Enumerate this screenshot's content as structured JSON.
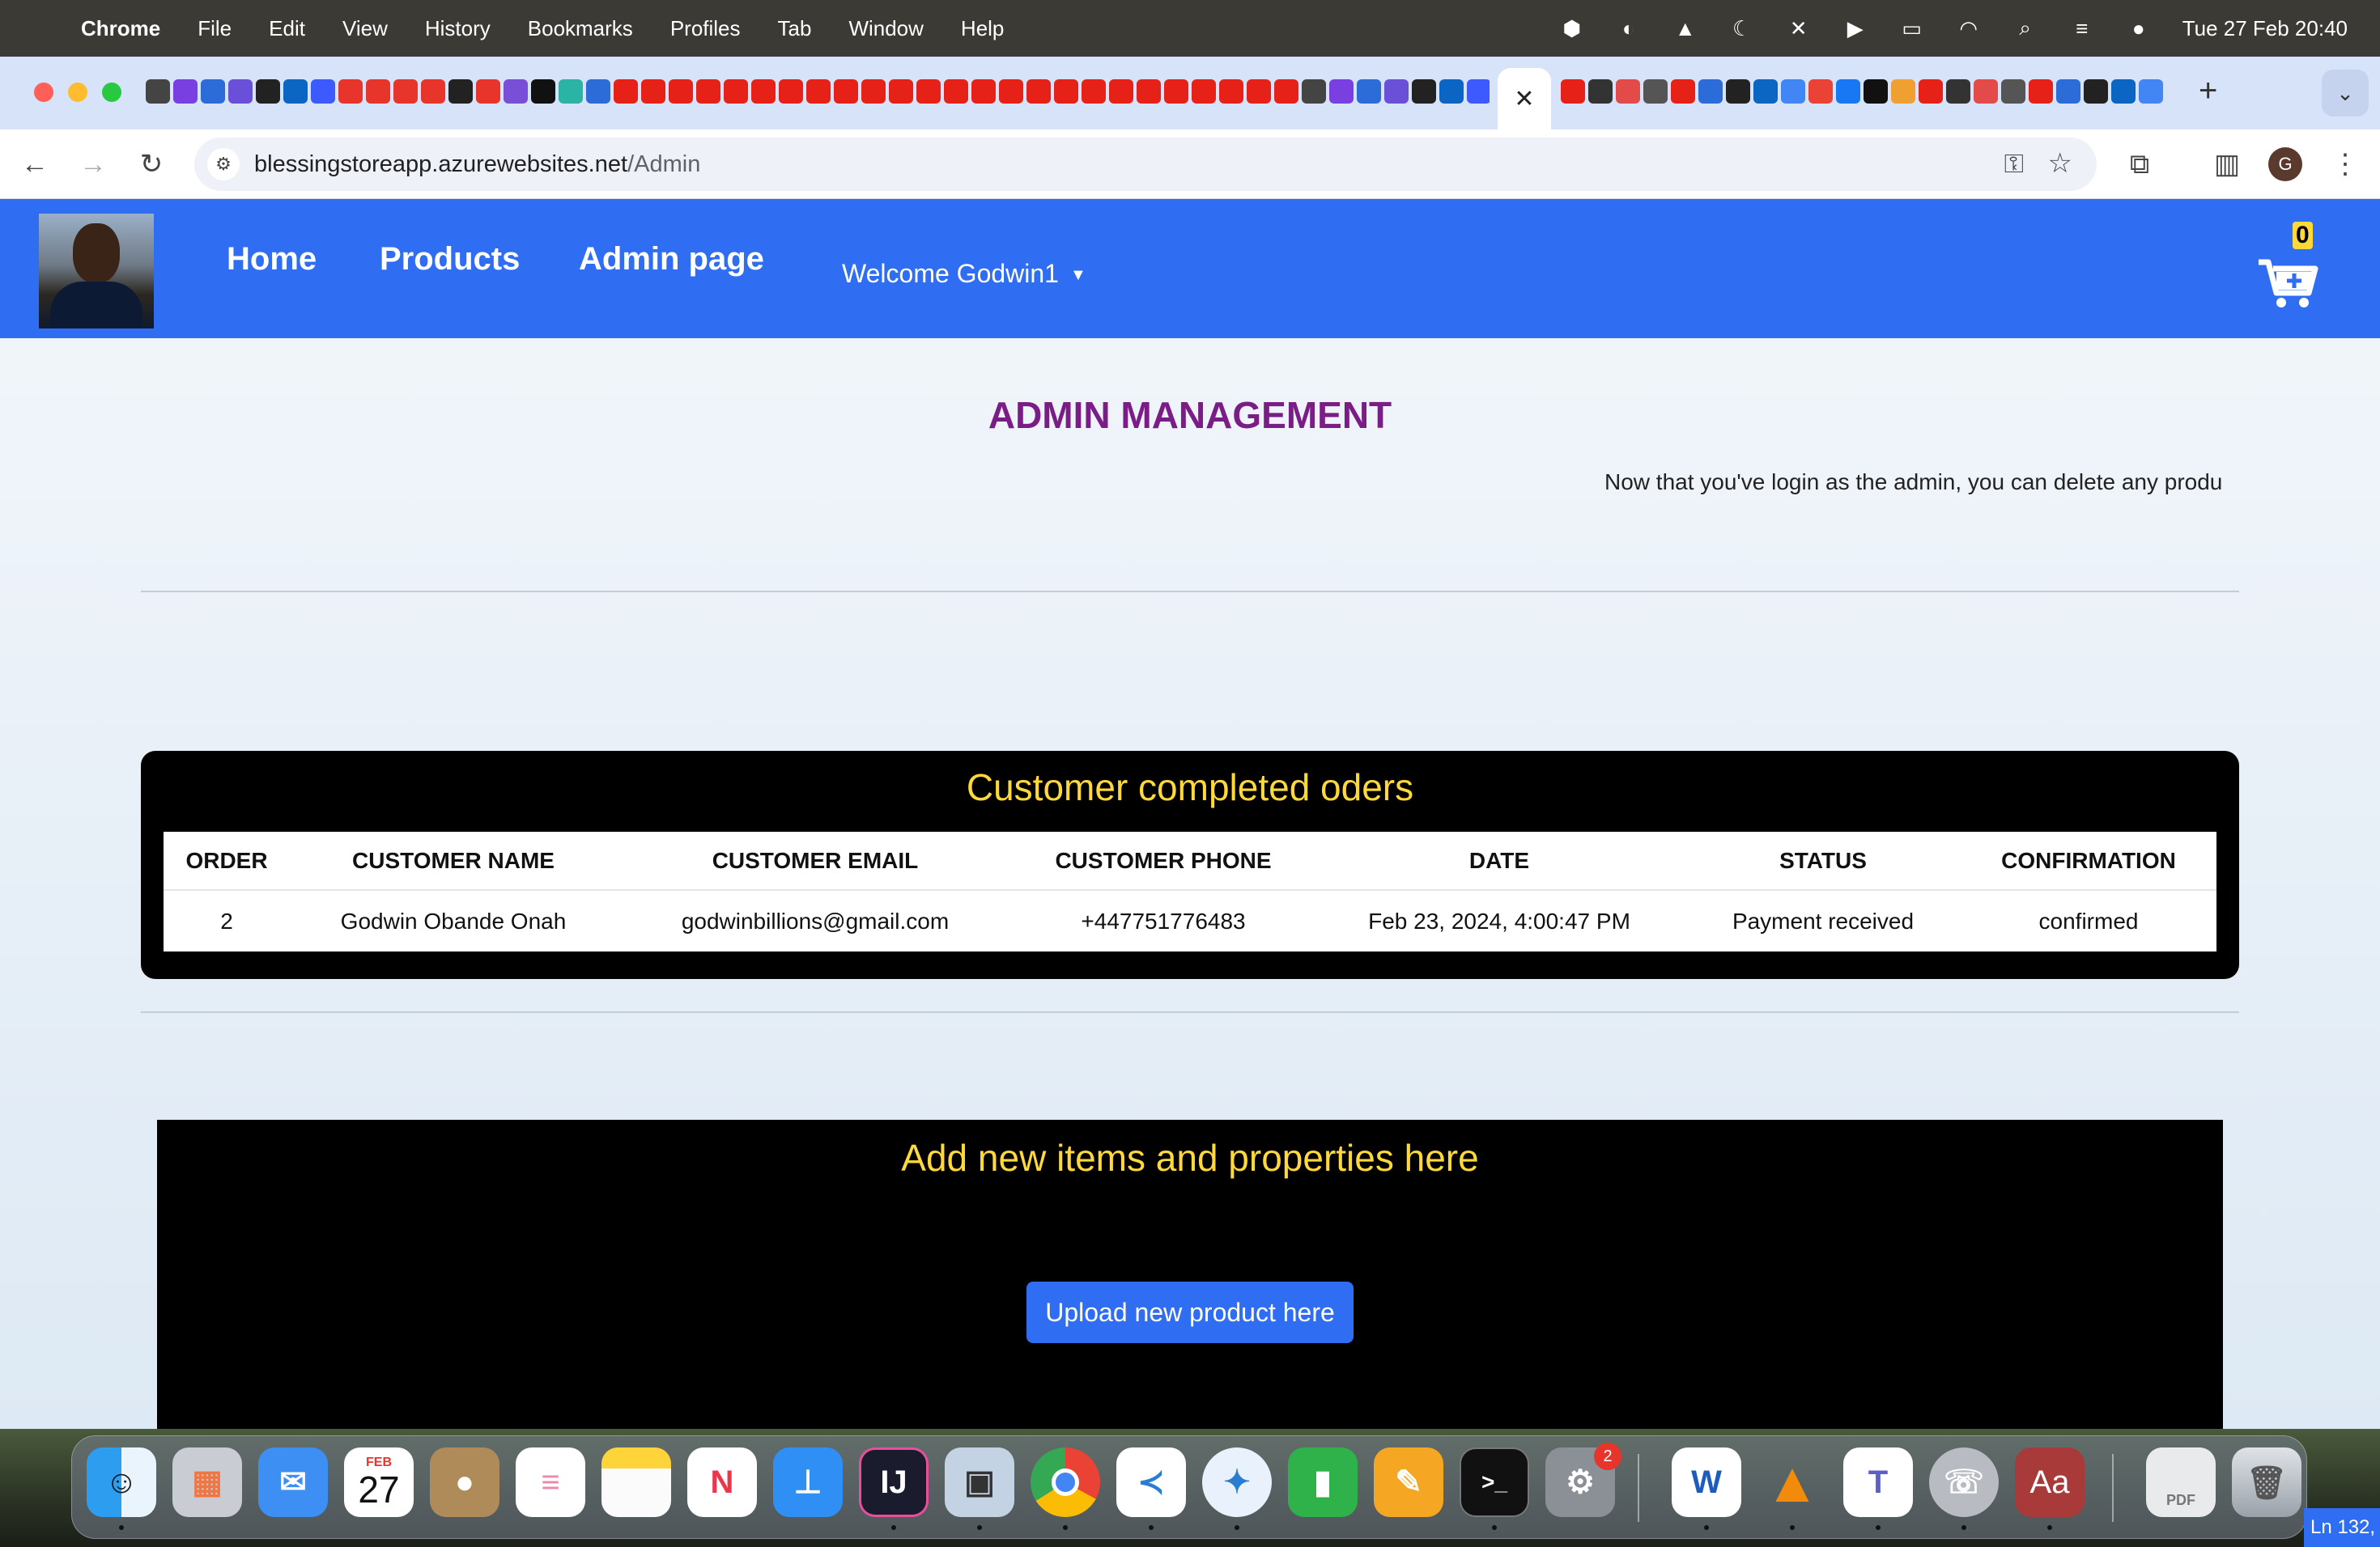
{
  "menubar": {
    "app_name": "Chrome",
    "items": [
      "File",
      "Edit",
      "View",
      "History",
      "Bookmarks",
      "Profiles",
      "Tab",
      "Window",
      "Help"
    ],
    "clock": "Tue 27 Feb  20:40"
  },
  "browser": {
    "address": {
      "host": "blessingstoreapp.azurewebsites.net",
      "path": "/Admin"
    },
    "profile_initial": "G"
  },
  "nav": {
    "links": [
      "Home",
      "Products",
      "Admin page"
    ],
    "welcome": "Welcome Godwin1",
    "cart_count": "0"
  },
  "page": {
    "title": "ADMIN MANAGEMENT",
    "notice": "Now that you've login as the admin, you can delete any produ"
  },
  "orders": {
    "title": "Customer completed oders",
    "columns": [
      "ORDER",
      "CUSTOMER NAME",
      "CUSTOMER EMAIL",
      "CUSTOMER PHONE",
      "DATE",
      "STATUS",
      "CONFIRMATION"
    ],
    "rows": [
      {
        "order": "2",
        "name": "Godwin Obande Onah",
        "email": "godwinbillions@gmail.com",
        "phone": "+447751776483",
        "date": "Feb 23, 2024, 4:00:47 PM",
        "status": "Payment received",
        "confirmation": "confirmed"
      }
    ]
  },
  "add_items": {
    "title": "Add new items and properties here",
    "upload_button": "Upload new product here"
  },
  "dock": {
    "calendar_month": "FEB",
    "calendar_day": "27",
    "settings_badge": "2",
    "word_label": "W",
    "dictionary_label": "Aa",
    "intellij_label": "IJ",
    "pdf_label": "PDF",
    "editor_status": "Ln 132,"
  },
  "colors": {
    "nav_blue": "#2f6ef2",
    "title_purple": "#7a1d86",
    "panel_yellow": "#ffd83a"
  }
}
